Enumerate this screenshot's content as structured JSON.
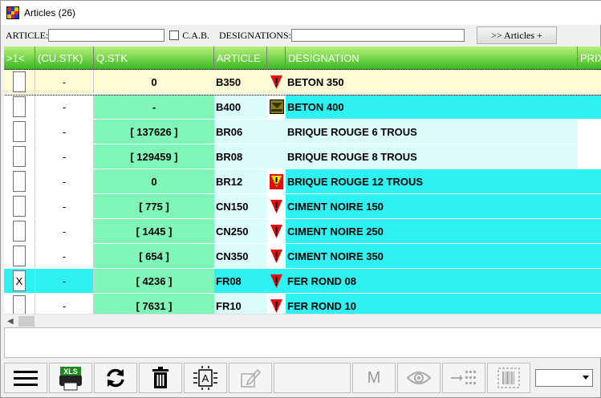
{
  "window": {
    "title": "Articles (26)"
  },
  "filters": {
    "article_label": "ARTICLE:",
    "cab_label": "C.A.B.",
    "designations_label": "DESIGNATIONS:",
    "articles_button": ">> Articles +"
  },
  "grid": {
    "columns": [
      ">1<",
      "(CU.STK)",
      "Q.STK",
      "ARTICLE",
      "",
      "DESIGNATION",
      "PRIX"
    ],
    "rows": [
      {
        "checked": "",
        "cu_stk": "-",
        "q_stk": "0",
        "article": "B350",
        "icon": "warning-red-icon",
        "designation": "BETON 350",
        "selected": true
      },
      {
        "checked": "",
        "cu_stk": "-",
        "q_stk": "-",
        "article": "B400",
        "icon": "inbox-icon",
        "designation": "BETON 400",
        "selected": false
      },
      {
        "checked": "",
        "cu_stk": "-",
        "q_stk": "[ 137626 ]",
        "article": "BR06",
        "icon": "",
        "designation": "BRIQUE ROUGE 6 TROUS",
        "selected": false
      },
      {
        "checked": "",
        "cu_stk": "-",
        "q_stk": "[ 129459 ]",
        "article": "BR08",
        "icon": "",
        "designation": "BRIQUE ROUGE 8 TROUS",
        "selected": false
      },
      {
        "checked": "",
        "cu_stk": "-",
        "q_stk": "0",
        "article": "BR12",
        "icon": "warning-yellow-icon",
        "designation": "BRIQUE ROUGE 12 TROUS",
        "selected": false
      },
      {
        "checked": "",
        "cu_stk": "-",
        "q_stk": "[ 775 ]",
        "article": "CN150",
        "icon": "warning-red-icon",
        "designation": "CIMENT NOIRE 150",
        "selected": false
      },
      {
        "checked": "",
        "cu_stk": "-",
        "q_stk": "[ 1445 ]",
        "article": "CN250",
        "icon": "warning-red-icon",
        "designation": "CIMENT NOIRE 250",
        "selected": false
      },
      {
        "checked": "",
        "cu_stk": "-",
        "q_stk": "[ 654 ]",
        "article": "CN350",
        "icon": "warning-red-icon",
        "designation": "CIMENT NOIRE 350",
        "selected": false
      },
      {
        "checked": "X",
        "cu_stk": "-",
        "q_stk": "[ 4236 ]",
        "article": "FR08",
        "icon": "warning-red-icon",
        "designation": "FER ROND 08",
        "selected": false
      },
      {
        "checked": "",
        "cu_stk": "-",
        "q_stk": "[ 7631 ]",
        "article": "FR10",
        "icon": "warning-red-icon",
        "designation": "FER ROND 10",
        "selected": false
      }
    ]
  },
  "toolbar": {
    "buttons": [
      "menu-icon",
      "excel-print-icon",
      "refresh-icon",
      "trash-icon",
      "label-icon",
      "edit-icon",
      "m-icon",
      "eye-icon",
      "transfer-icon",
      "barcode-icon"
    ],
    "m_label": "M"
  },
  "colors": {
    "header_green": "#35b81c",
    "qstk_green": "#80f5b8",
    "cyan": "#2ef2f2",
    "light_cyan": "#dcfbfb",
    "selected_row": "#fffbd6"
  }
}
